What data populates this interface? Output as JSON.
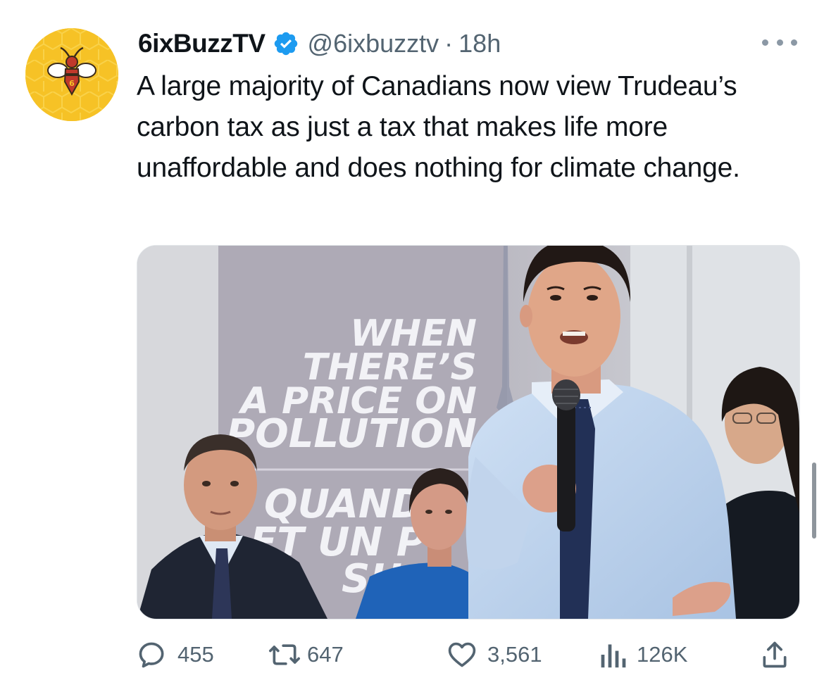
{
  "tweet": {
    "display_name": "6ixBuzzTV",
    "verified_icon": "verified-badge-icon",
    "handle": "@6ixbuzztv",
    "separator": "·",
    "time": "18h",
    "text": "A large majority of Canadians now view Trudeau’s carbon tax as just a tax that makes life more unaffordable and does nothing for climate change.",
    "media": {
      "banner_text": [
        "WHEN",
        "THERE’S",
        "A PRICE ON",
        "POLLUTION"
      ],
      "banner_text_french": [
        "QUAND",
        "ET UN P",
        "SU"
      ]
    }
  },
  "actions": {
    "replies": "455",
    "retweets": "647",
    "likes": "3,561",
    "views": "126K"
  },
  "colors": {
    "brand_blue": "#1d9bf0",
    "muted_text": "#536471",
    "avatar_yellow": "#f6c226"
  }
}
